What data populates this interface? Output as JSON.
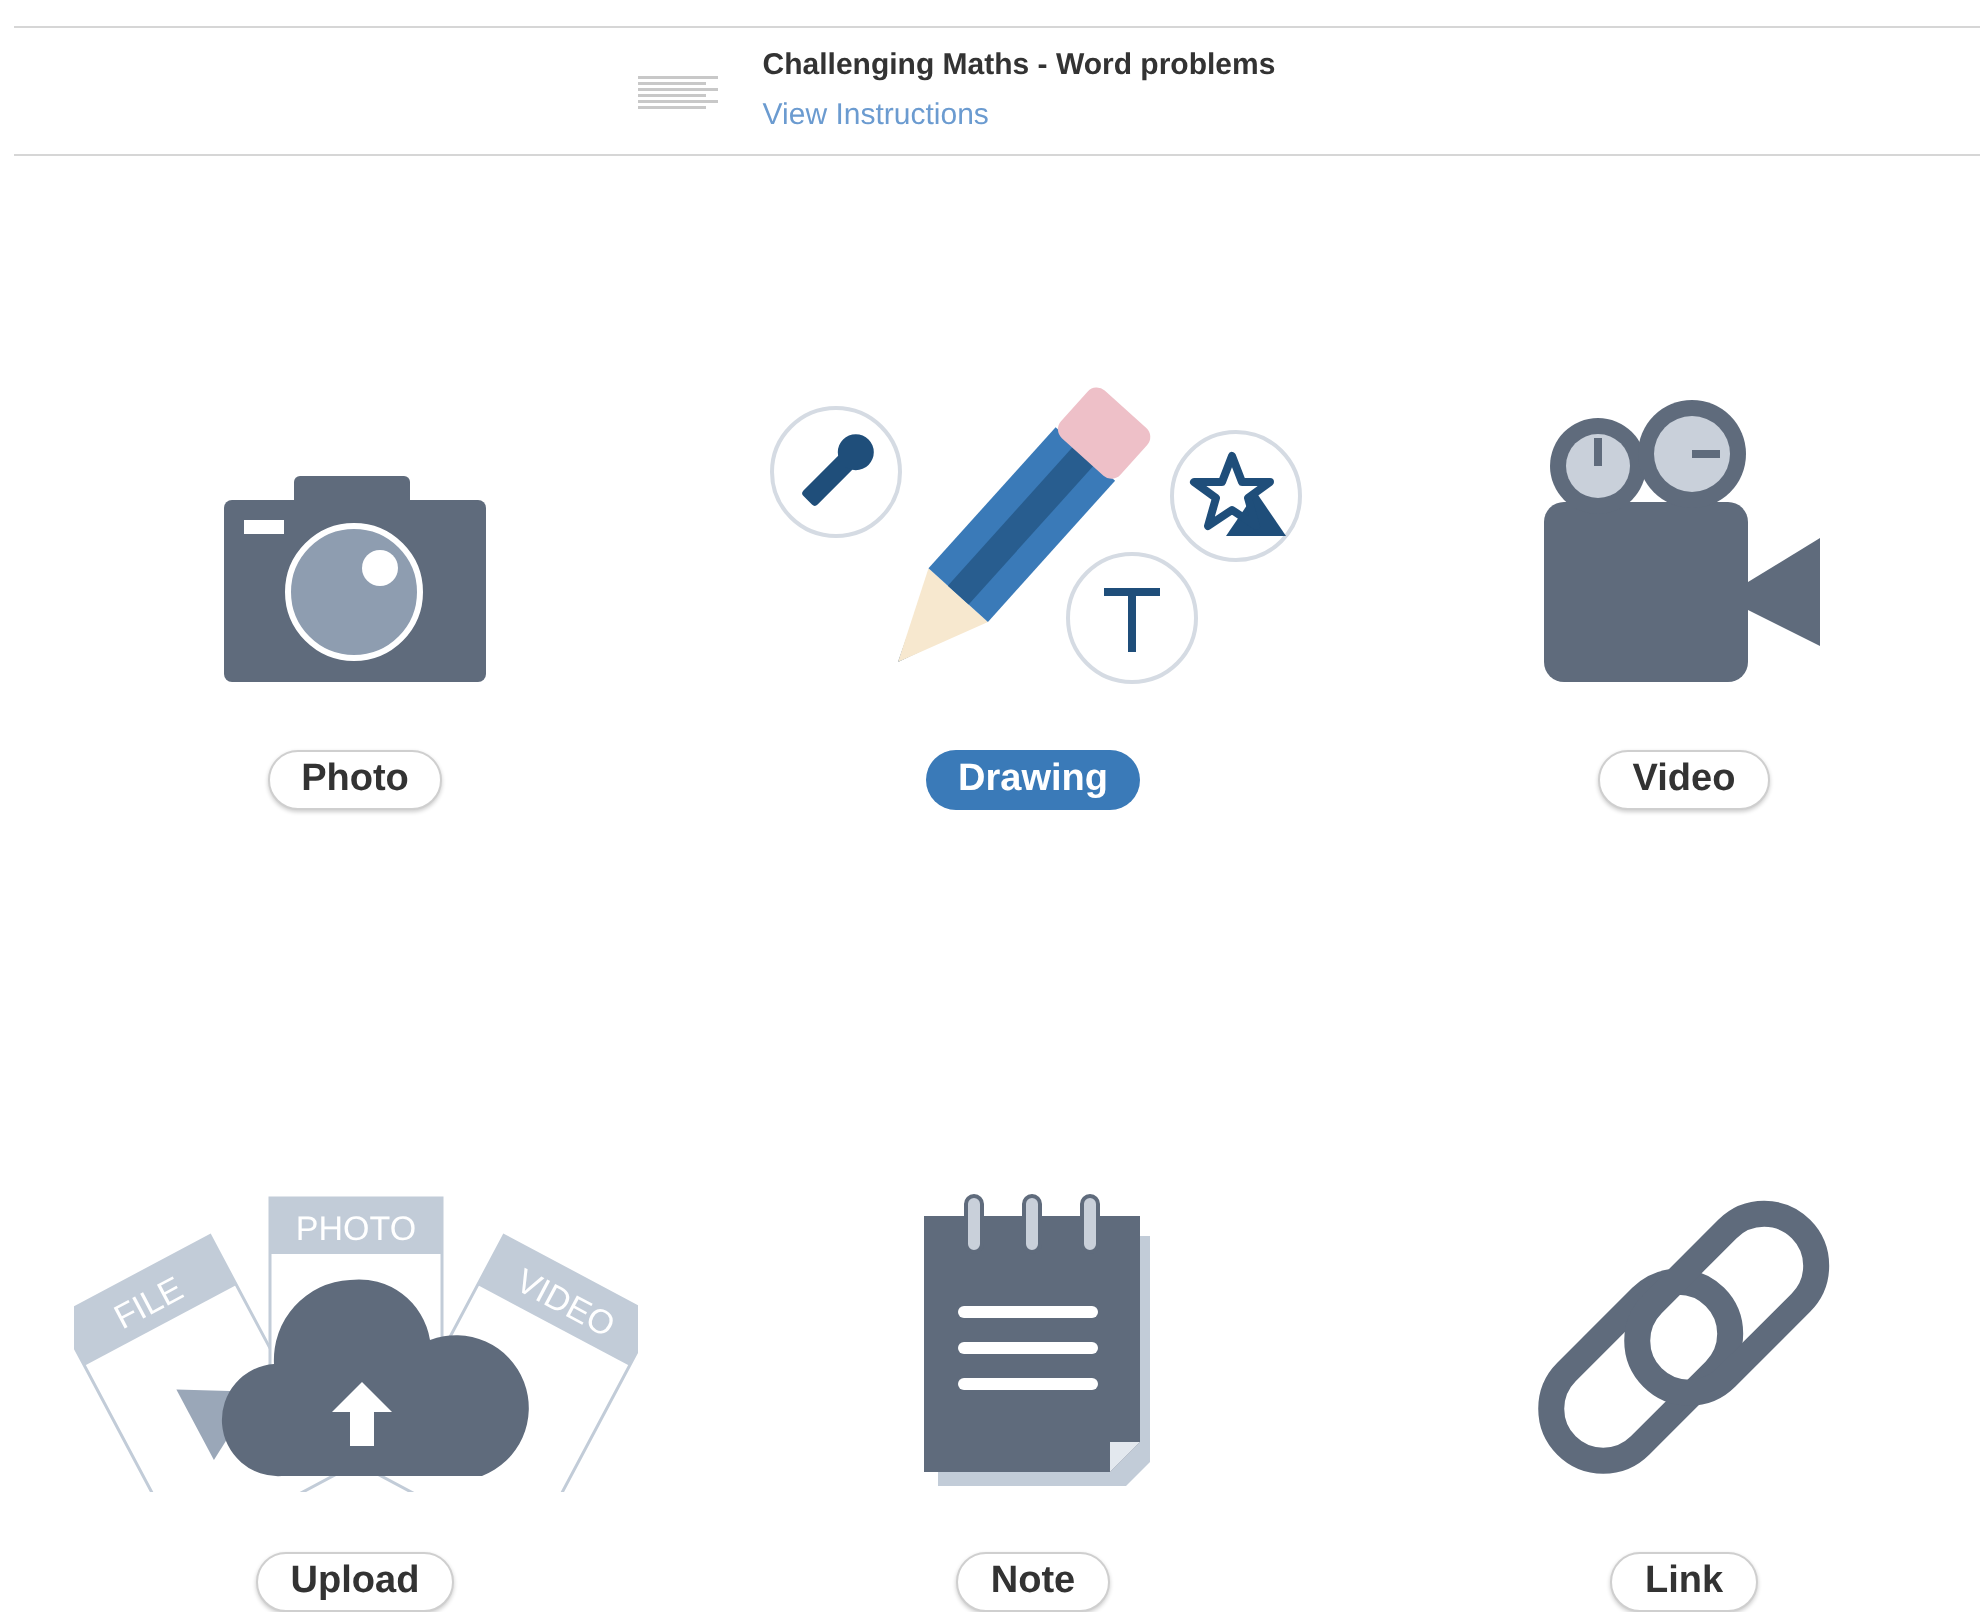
{
  "header": {
    "title": "Challenging Maths - Word problems",
    "link": "View Instructions"
  },
  "options": [
    {
      "kind": "photo",
      "label": "Photo",
      "selected": false
    },
    {
      "kind": "drawing",
      "label": "Drawing",
      "selected": true
    },
    {
      "kind": "video",
      "label": "Video",
      "selected": false
    },
    {
      "kind": "upload",
      "label": "Upload",
      "selected": false,
      "card_labels": [
        "FILE",
        "PHOTO",
        "VIDEO"
      ]
    },
    {
      "kind": "note",
      "label": "Note",
      "selected": false
    },
    {
      "kind": "link",
      "label": "Link",
      "selected": false
    }
  ]
}
